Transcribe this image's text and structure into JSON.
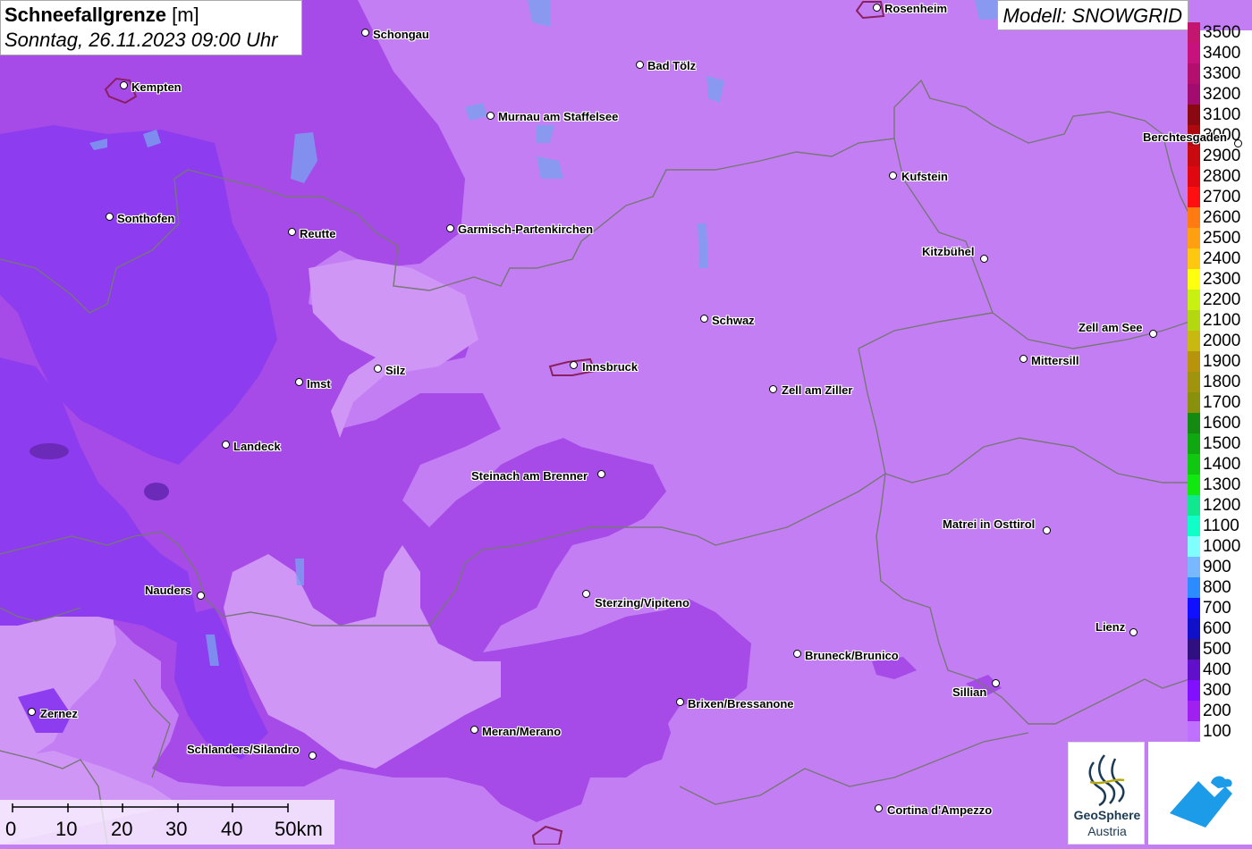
{
  "title": {
    "main": "Schneefallgrenze",
    "unit": "[m]",
    "datetime": "Sonntag, 26.11.2023 09:00 Uhr"
  },
  "model": "Modell: SNOWGRID",
  "legend": [
    {
      "label": "3500",
      "color": "#c4166f"
    },
    {
      "label": "3400",
      "color": "#c7127e"
    },
    {
      "label": "3300",
      "color": "#b30f6e"
    },
    {
      "label": "3200",
      "color": "#a20c6e"
    },
    {
      "label": "3100",
      "color": "#8a0810"
    },
    {
      "label": "3000",
      "color": "#ad0a10"
    },
    {
      "label": "2900",
      "color": "#c80a10"
    },
    {
      "label": "2800",
      "color": "#e00810"
    },
    {
      "label": "2700",
      "color": "#ff1010"
    },
    {
      "label": "2600",
      "color": "#ff7a10"
    },
    {
      "label": "2500",
      "color": "#ffa010"
    },
    {
      "label": "2400",
      "color": "#ffc810"
    },
    {
      "label": "2300",
      "color": "#ffff10"
    },
    {
      "label": "2200",
      "color": "#c8f010"
    },
    {
      "label": "2100",
      "color": "#b4d810"
    },
    {
      "label": "2000",
      "color": "#c8b810"
    },
    {
      "label": "1900",
      "color": "#b8940c"
    },
    {
      "label": "1800",
      "color": "#a0940c"
    },
    {
      "label": "1700",
      "color": "#88900c"
    },
    {
      "label": "1600",
      "color": "#148a10"
    },
    {
      "label": "1500",
      "color": "#10a810"
    },
    {
      "label": "1400",
      "color": "#10c810"
    },
    {
      "label": "1300",
      "color": "#10e810"
    },
    {
      "label": "1200",
      "color": "#10e890"
    },
    {
      "label": "1100",
      "color": "#10ffc8"
    },
    {
      "label": "1000",
      "color": "#80ffff"
    },
    {
      "label": "900",
      "color": "#78b8ff"
    },
    {
      "label": "800",
      "color": "#2c8cff"
    },
    {
      "label": "700",
      "color": "#1010ff"
    },
    {
      "label": "600",
      "color": "#1010c8"
    },
    {
      "label": "500",
      "color": "#301080"
    },
    {
      "label": "400",
      "color": "#6010c8"
    },
    {
      "label": "300",
      "color": "#8010ff"
    },
    {
      "label": "200",
      "color": "#a020f0"
    },
    {
      "label": "100",
      "color": "#c070ff"
    }
  ],
  "cities": [
    {
      "name": "Rosenheim"
    },
    {
      "name": "Schongau"
    },
    {
      "name": "Bad Tölz"
    },
    {
      "name": "Kempten"
    },
    {
      "name": "Murnau am Staffelsee"
    },
    {
      "name": "Berchtesgaden"
    },
    {
      "name": "Kufstein"
    },
    {
      "name": "Sonthofen"
    },
    {
      "name": "Reutte"
    },
    {
      "name": "Garmisch-Partenkirchen"
    },
    {
      "name": "Kitzbühel"
    },
    {
      "name": "Schwaz"
    },
    {
      "name": "Zell am See"
    },
    {
      "name": "Innsbruck"
    },
    {
      "name": "Silz"
    },
    {
      "name": "Mittersill"
    },
    {
      "name": "Imst"
    },
    {
      "name": "Zell am Ziller"
    },
    {
      "name": "Landeck"
    },
    {
      "name": "Steinach am Brenner"
    },
    {
      "name": "Matrei in Osttirol"
    },
    {
      "name": "Nauders"
    },
    {
      "name": "Sterzing/Vipiteno"
    },
    {
      "name": "Lienz"
    },
    {
      "name": "Bruneck/Brunico"
    },
    {
      "name": "Sillian"
    },
    {
      "name": "Brixen/Bressanone"
    },
    {
      "name": "Zernez"
    },
    {
      "name": "Meran/Merano"
    },
    {
      "name": "Schlanders/Silandro"
    },
    {
      "name": "Cortina d'Ampezzo"
    }
  ],
  "scale": {
    "labels": [
      "0",
      "10",
      "20",
      "30",
      "40",
      "50km"
    ]
  },
  "logos": {
    "geosphere_line1": "GeoSphere",
    "geosphere_line2": "Austria"
  },
  "colors": {
    "background_100": "#c47ef4",
    "zone_200": "#a64ae8",
    "zone_300": "#8d3cf0",
    "zone_pale": "#cf96f6",
    "border": "#777777"
  }
}
